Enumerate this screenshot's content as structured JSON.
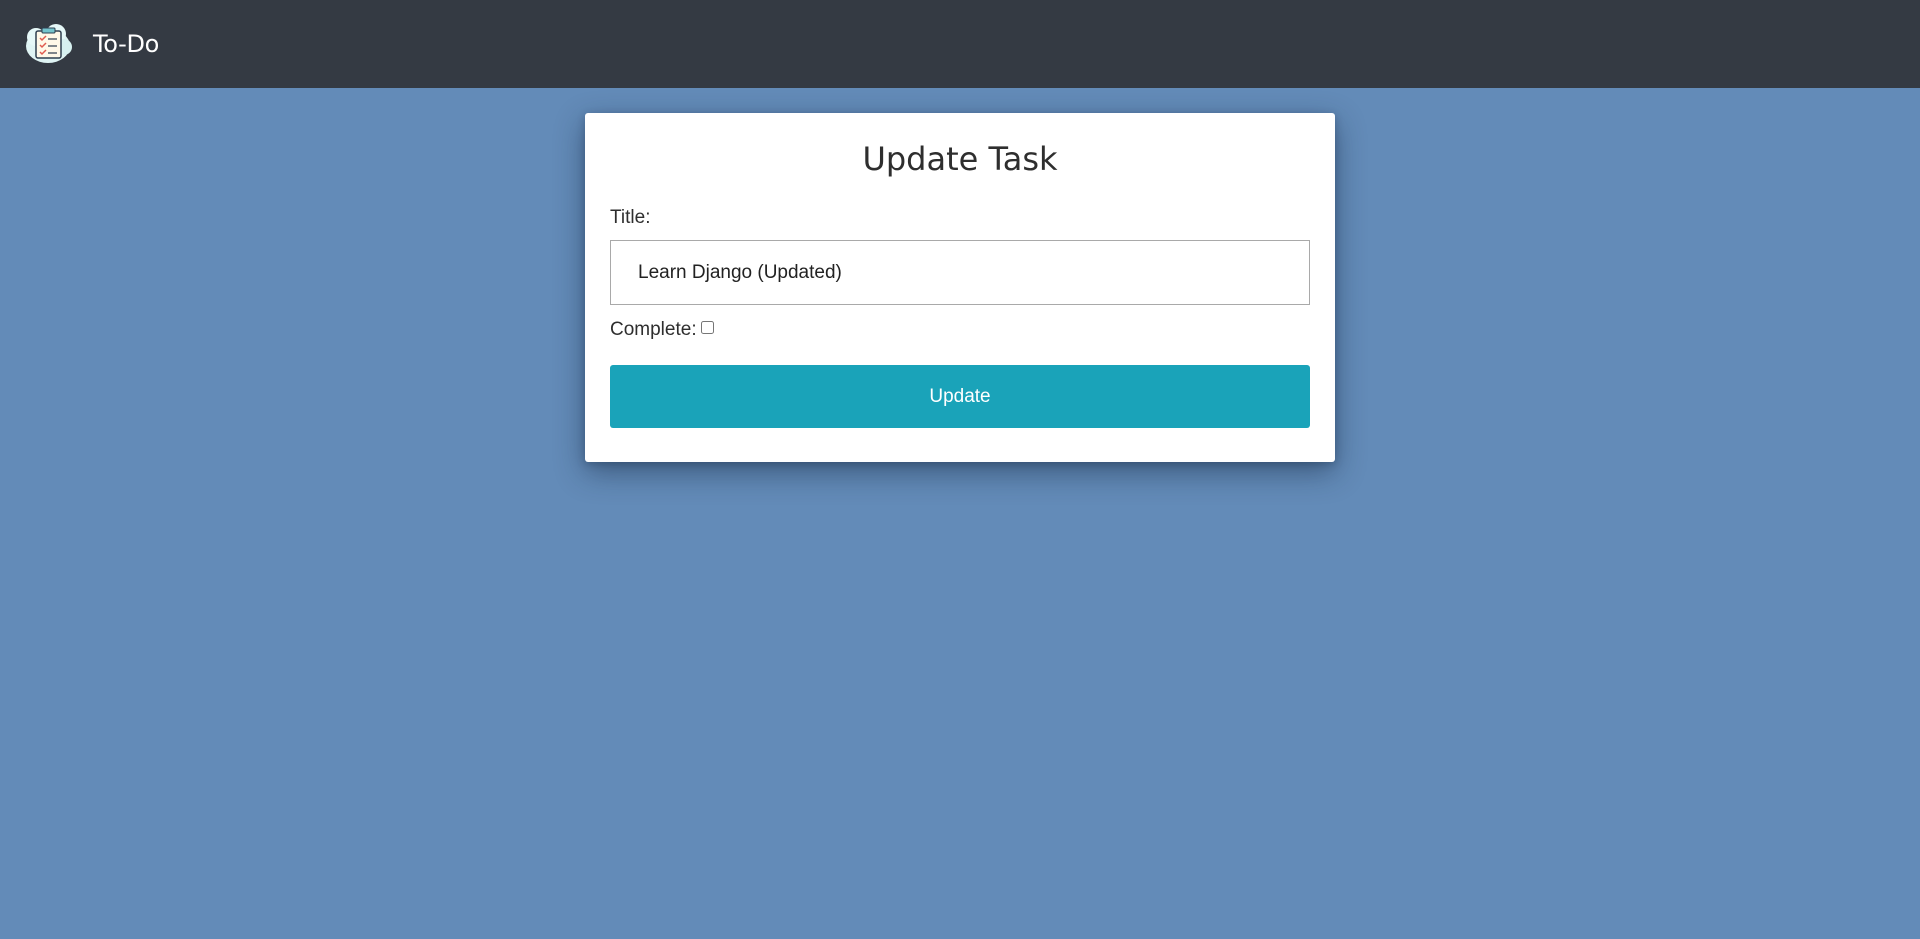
{
  "navbar": {
    "brand_name": "To-Do",
    "logo_icon": "checklist-cloud-icon"
  },
  "form": {
    "page_title": "Update Task",
    "title_label": "Title:",
    "title_value": "Learn Django (Updated)",
    "complete_label": "Complete:",
    "complete_checked": false,
    "submit_label": "Update"
  },
  "colors": {
    "navbar_background": "#343a43",
    "page_background": "#638bb8",
    "card_background": "#ffffff",
    "button_background": "#1aa3b9"
  }
}
